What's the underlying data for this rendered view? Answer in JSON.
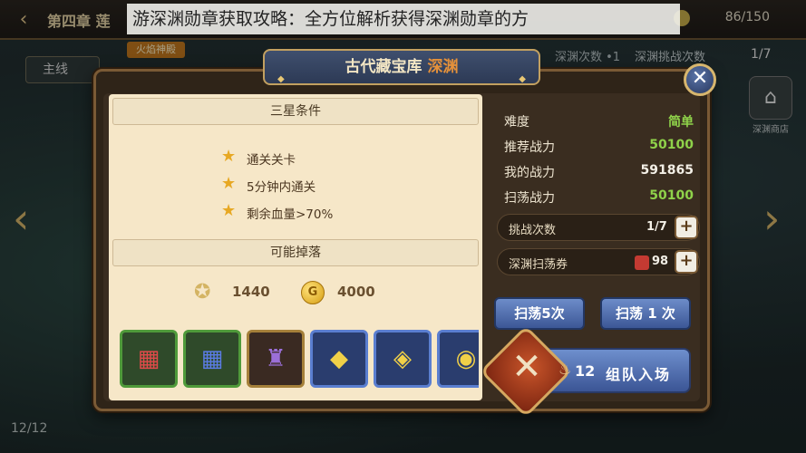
{
  "caption": "游深渊勋章获取攻略：全方位解析获得深渊勋章的方",
  "hud": {
    "chapter": "第四章 莲",
    "stamina": "86/150",
    "main_tab": "主线",
    "new_badge": "火焰神殿",
    "right_info_1": "深渊次数 •1",
    "right_info_2": "深渊挑战次数",
    "right_count": "1/7",
    "shop_label": "深渊商店",
    "bottom_count": "12/12",
    "back_icon": "back-arrow-icon",
    "nav_left_glyph": "‹",
    "nav_right_glyph": "›"
  },
  "dialog": {
    "title": "古代藏宝库",
    "title_tag": "深渊",
    "close_glyph": "✕",
    "stars_section": "三星条件",
    "conditions": [
      "通关关卡",
      "5分钟内通关",
      "剩余血量>70%"
    ],
    "drops_section": "可能掉落",
    "reward_exp": "1440",
    "reward_gold": "4000",
    "items": [
      {
        "name": "red-rune-cube",
        "color": "#c93a3a",
        "border": "#3f8a3a",
        "glyph": "▦"
      },
      {
        "name": "blue-rune-cube",
        "color": "#3c5fc2",
        "border": "#3f8a3a",
        "glyph": "▦"
      },
      {
        "name": "dark-armor",
        "color": "#5a3e7a",
        "border": "#8a6a2a",
        "glyph": "♜"
      },
      {
        "name": "gold-amulet",
        "color": "#3a5aa8",
        "border": "#3f62b0",
        "glyph": "◆"
      },
      {
        "name": "gold-earrings",
        "color": "#3a5aa8",
        "border": "#3f62b0",
        "glyph": "◈"
      },
      {
        "name": "gold-ring",
        "color": "#3a5aa8",
        "border": "#3f62b0",
        "glyph": "◉"
      }
    ],
    "stats": [
      {
        "label": "难度",
        "value": "简单",
        "color": "#8fd24a"
      },
      {
        "label": "推荐战力",
        "value": "50100",
        "color": "#8fd24a"
      },
      {
        "label": "我的战力",
        "value": "591865",
        "color": "#f3efe6"
      },
      {
        "label": "扫荡战力",
        "value": "50100",
        "color": "#8fd24a"
      }
    ],
    "challenge": {
      "label": "挑战次数",
      "value": "1/7"
    },
    "ticket": {
      "label": "深渊扫荡券",
      "value": "98"
    },
    "sweep5_label": "扫荡5次",
    "sweep1_label": "扫荡 1 次",
    "team": {
      "cost": "12",
      "label": "组队入场"
    }
  }
}
